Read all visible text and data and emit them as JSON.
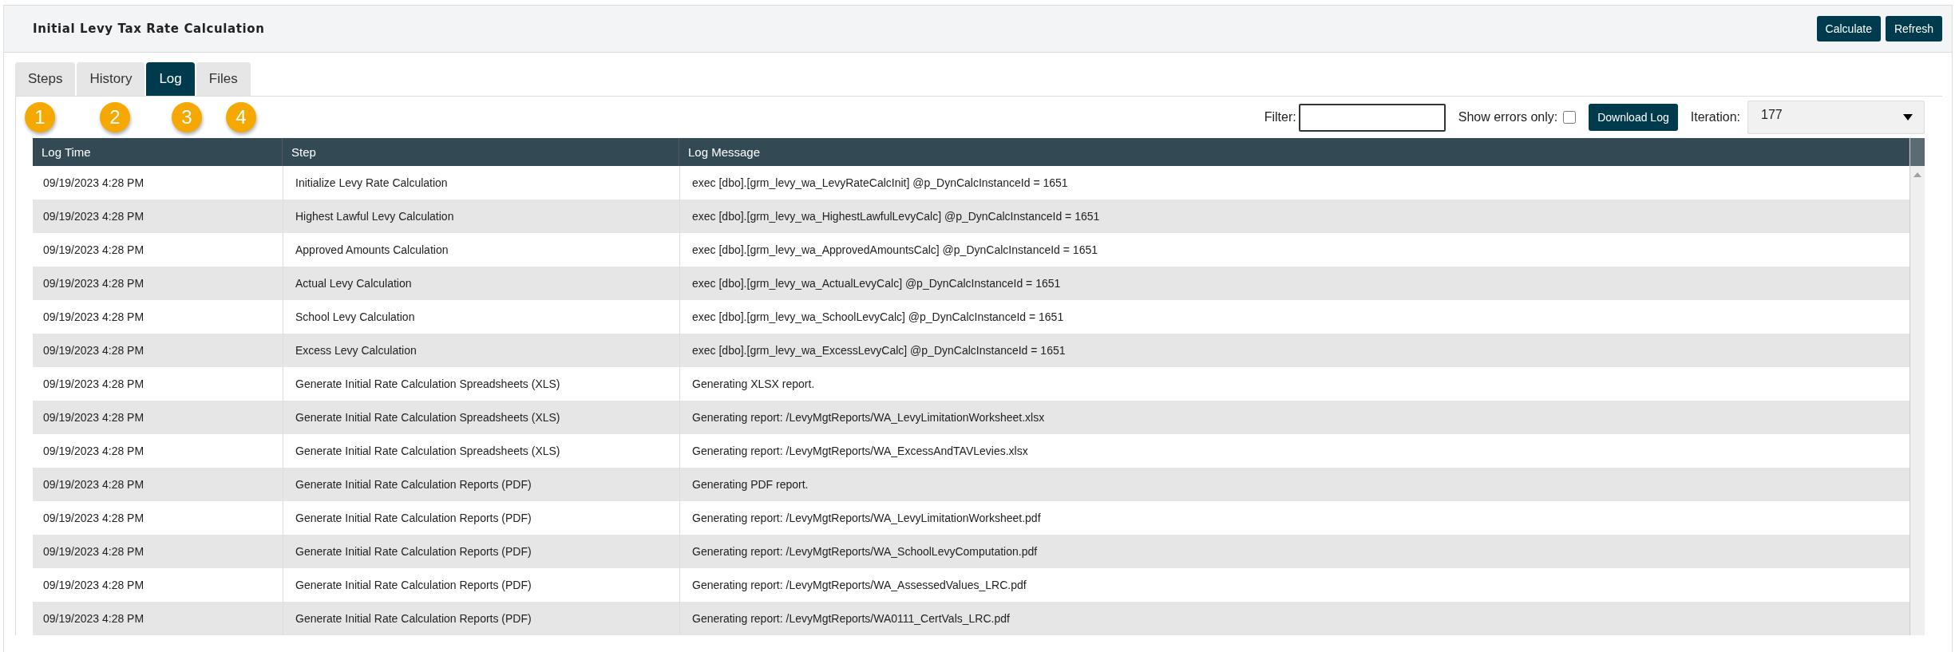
{
  "header": {
    "title": "Initial Levy Tax Rate Calculation",
    "buttons": [
      "Calculate",
      "Refresh"
    ]
  },
  "tabs": [
    {
      "label": "Steps",
      "selected": false
    },
    {
      "label": "History",
      "selected": false
    },
    {
      "label": "Log",
      "selected": true
    },
    {
      "label": "Files",
      "selected": false
    }
  ],
  "callouts": [
    "1",
    "2",
    "3",
    "4"
  ],
  "toolbar": {
    "filter_label": "Filter:",
    "errors_label": "Show errors only:",
    "errors_checked": false,
    "download_button": "Download Log",
    "iteration_label": "Iteration:",
    "iteration_value": "177"
  },
  "table": {
    "columns": [
      "Log Time",
      "Step",
      "Log Message"
    ],
    "rows": [
      [
        "09/19/2023 4:28 PM",
        "Initialize Levy Rate Calculation",
        "exec [dbo].[grm_levy_wa_LevyRateCalcInit] @p_DynCalcInstanceId = 1651"
      ],
      [
        "09/19/2023 4:28 PM",
        "Highest Lawful Levy Calculation",
        "exec [dbo].[grm_levy_wa_HighestLawfulLevyCalc] @p_DynCalcInstanceId = 1651"
      ],
      [
        "09/19/2023 4:28 PM",
        "Approved Amounts Calculation",
        "exec [dbo].[grm_levy_wa_ApprovedAmountsCalc] @p_DynCalcInstanceId = 1651"
      ],
      [
        "09/19/2023 4:28 PM",
        "Actual Levy Calculation",
        "exec [dbo].[grm_levy_wa_ActualLevyCalc] @p_DynCalcInstanceId = 1651"
      ],
      [
        "09/19/2023 4:28 PM",
        "School Levy Calculation",
        "exec [dbo].[grm_levy_wa_SchoolLevyCalc] @p_DynCalcInstanceId = 1651"
      ],
      [
        "09/19/2023 4:28 PM",
        "Excess Levy Calculation",
        "exec [dbo].[grm_levy_wa_ExcessLevyCalc] @p_DynCalcInstanceId = 1651"
      ],
      [
        "09/19/2023 4:28 PM",
        "Generate Initial Rate Calculation Spreadsheets (XLS)",
        "Generating XLSX report."
      ],
      [
        "09/19/2023 4:28 PM",
        "Generate Initial Rate Calculation Spreadsheets (XLS)",
        "Generating report: /LevyMgtReports/WA_LevyLimitationWorksheet.xlsx"
      ],
      [
        "09/19/2023 4:28 PM",
        "Generate Initial Rate Calculation Spreadsheets (XLS)",
        "Generating report: /LevyMgtReports/WA_ExcessAndTAVLevies.xlsx"
      ],
      [
        "09/19/2023 4:28 PM",
        "Generate Initial Rate Calculation Reports (PDF)",
        "Generating PDF report."
      ],
      [
        "09/19/2023 4:28 PM",
        "Generate Initial Rate Calculation Reports (PDF)",
        "Generating report: /LevyMgtReports/WA_LevyLimitationWorksheet.pdf"
      ],
      [
        "09/19/2023 4:28 PM",
        "Generate Initial Rate Calculation Reports (PDF)",
        "Generating report: /LevyMgtReports/WA_SchoolLevyComputation.pdf"
      ],
      [
        "09/19/2023 4:28 PM",
        "Generate Initial Rate Calculation Reports (PDF)",
        "Generating report: /LevyMgtReports/WA_AssessedValues_LRC.pdf"
      ],
      [
        "09/19/2023 4:28 PM",
        "Generate Initial Rate Calculation Reports (PDF)",
        "Generating report: /LevyMgtReports/WA0111_CertVals_LRC.pdf"
      ]
    ]
  }
}
